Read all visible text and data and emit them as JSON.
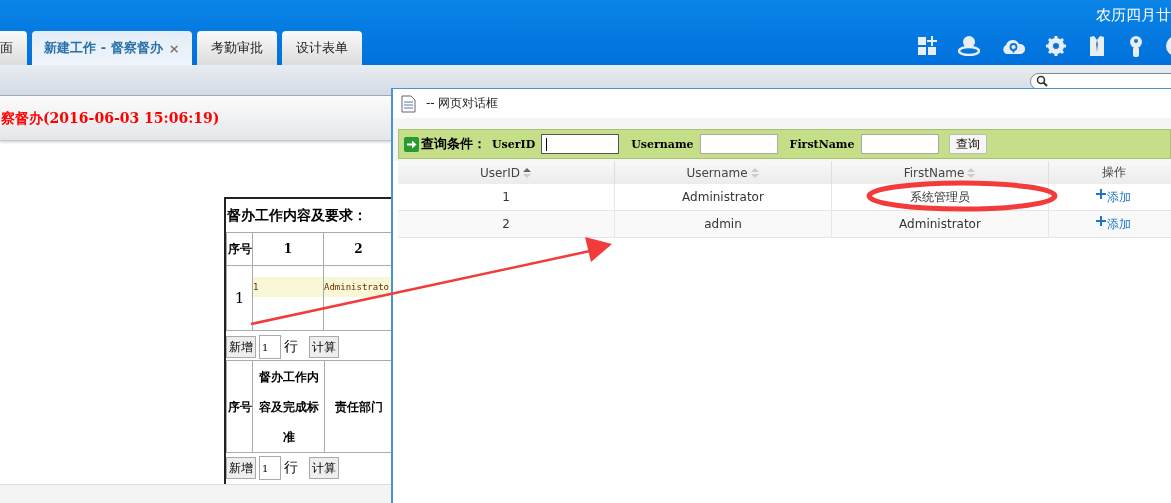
{
  "header": {
    "date": "农历四月廿",
    "tabs": [
      {
        "label": "面",
        "selected": false
      },
      {
        "label": "新建工作 - 督察督办",
        "selected": true,
        "close": "×"
      },
      {
        "label": "考勤审批",
        "selected": false
      },
      {
        "label": "设计表单",
        "selected": false
      }
    ]
  },
  "form_panel": {
    "title": "察督办(2016-06-03 15:06:19)",
    "section_title": "督办工作内容及要求：",
    "table1": {
      "columns": [
        "序号",
        "1",
        "2"
      ],
      "rows": [
        {
          "cells": [
            "1",
            "1",
            "Administrato"
          ]
        }
      ]
    },
    "add_row": {
      "add_button": "新增",
      "count": "1",
      "unit": "行",
      "calc_button": "计算"
    },
    "table2": {
      "columns": [
        "序号",
        "督办工作内容及完成标准",
        "责任部门"
      ]
    },
    "add_row_2": {
      "add_button": "新增",
      "count": "1",
      "unit": "行",
      "calc_button": "计算"
    }
  },
  "dialog": {
    "title": "-- 网页对话框",
    "query": {
      "label": "查询条件：",
      "fields": [
        {
          "label": "UserID",
          "focused": true
        },
        {
          "label": "Username",
          "focused": false
        },
        {
          "label": "FirstName",
          "focused": false
        }
      ],
      "button": "查询"
    },
    "table": {
      "columns": [
        {
          "label": "UserID",
          "sorted": true
        },
        {
          "label": "Username",
          "sorted": false
        },
        {
          "label": "FirstName",
          "sorted": false
        },
        {
          "label": "操作"
        }
      ],
      "rows": [
        {
          "cells": [
            "1",
            "Administrator",
            "系统管理员"
          ],
          "action": "添加"
        },
        {
          "cells": [
            "2",
            "admin",
            "Administrator"
          ],
          "action": "添加"
        }
      ]
    }
  },
  "annotations": {
    "circle_mark": true,
    "arrow_mark": true
  }
}
